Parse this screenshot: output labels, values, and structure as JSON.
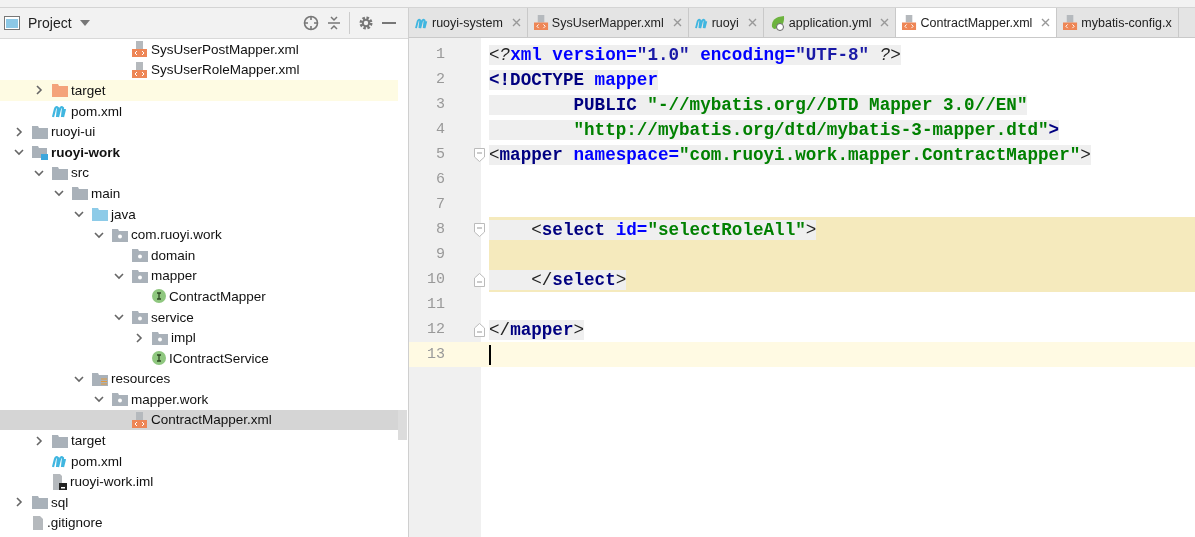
{
  "project_panel": {
    "title": "Project"
  },
  "tree": [
    {
      "children": [
        {
          "children": [
            {
              "children": [
                {
                  "children": [
                    {
                      "children": [
                        {
                          "name": "SysUserPostMapper.xml",
                          "kind": "xml",
                          "selected": false,
                          "highlighted": false
                        },
                        {
                          "name": "SysUserRoleMapper.xml",
                          "kind": "xml",
                          "selected": false,
                          "highlighted": false
                        }
                      ]
                    }
                  ]
                }
              ]
            }
          ]
        },
        {
          "name": "target",
          "kind": "excluded",
          "expanded": false,
          "selected": false,
          "highlighted": true
        },
        {
          "name": "pom.xml",
          "kind": "maven",
          "selected": false,
          "highlighted": false
        }
      ]
    },
    {
      "name": "ruoyi-ui",
      "kind": "folder",
      "expanded": false,
      "selected": false,
      "highlighted": false
    },
    {
      "name": "ruoyi-work",
      "kind": "module",
      "bold": true,
      "expanded": true,
      "selected": false,
      "highlighted": false,
      "children": [
        {
          "name": "src",
          "kind": "folder",
          "expanded": true,
          "selected": false,
          "highlighted": false,
          "children": [
            {
              "name": "main",
              "kind": "folder",
              "expanded": true,
              "selected": false,
              "highlighted": false,
              "children": [
                {
                  "name": "java",
                  "kind": "source",
                  "expanded": true,
                  "selected": false,
                  "highlighted": false,
                  "children": [
                    {
                      "name": "com.ruoyi.work",
                      "kind": "package",
                      "expanded": true,
                      "selected": false,
                      "highlighted": false,
                      "children": [
                        {
                          "name": "domain",
                          "kind": "package",
                          "selected": false,
                          "highlighted": false
                        },
                        {
                          "name": "mapper",
                          "kind": "package",
                          "expanded": true,
                          "selected": false,
                          "highlighted": false,
                          "children": [
                            {
                              "name": "ContractMapper",
                              "kind": "interface",
                              "selected": false,
                              "highlighted": false
                            }
                          ]
                        },
                        {
                          "name": "service",
                          "kind": "package",
                          "expanded": true,
                          "selected": false,
                          "highlighted": false,
                          "children": [
                            {
                              "name": "impl",
                              "kind": "package",
                              "expanded": false,
                              "selected": false,
                              "highlighted": false
                            },
                            {
                              "name": "IContractService",
                              "kind": "interface",
                              "selected": false,
                              "highlighted": false
                            }
                          ]
                        }
                      ]
                    }
                  ]
                },
                {
                  "name": "resources",
                  "kind": "resources",
                  "expanded": true,
                  "selected": false,
                  "highlighted": false,
                  "children": [
                    {
                      "name": "mapper.work",
                      "kind": "package",
                      "expanded": true,
                      "selected": false,
                      "highlighted": false,
                      "children": [
                        {
                          "name": "ContractMapper.xml",
                          "kind": "xml",
                          "selected": true,
                          "highlighted": false
                        }
                      ]
                    }
                  ]
                }
              ]
            }
          ]
        },
        {
          "name": "target",
          "kind": "folder",
          "expanded": false,
          "selected": false,
          "highlighted": false
        },
        {
          "name": "pom.xml",
          "kind": "maven",
          "selected": false,
          "highlighted": false
        },
        {
          "name": "ruoyi-work.iml",
          "kind": "iml",
          "selected": false,
          "highlighted": false
        }
      ]
    },
    {
      "name": "sql",
      "kind": "folder",
      "expanded": false,
      "selected": false,
      "highlighted": false
    },
    {
      "name": ".gitignore",
      "kind": "file",
      "selected": false,
      "highlighted": false
    }
  ],
  "tabs": [
    {
      "label": "ruoyi-system",
      "kind": "maven",
      "selected": false,
      "closable": true
    },
    {
      "label": "SysUserMapper.xml",
      "kind": "xml",
      "selected": false,
      "closable": true
    },
    {
      "label": "ruoyi",
      "kind": "maven",
      "selected": false,
      "closable": true
    },
    {
      "label": "application.yml",
      "kind": "spring",
      "selected": false,
      "closable": true
    },
    {
      "label": "ContractMapper.xml",
      "kind": "xml",
      "selected": true,
      "closable": true
    },
    {
      "label": "mybatis-config.x",
      "kind": "xml",
      "selected": false,
      "closable": false
    }
  ],
  "editor": {
    "lines": [
      {
        "number": "1",
        "fold_start": false,
        "fold_end": false,
        "highlighted": false,
        "current": false,
        "tokens": [
          {
            "kind": "pi",
            "text": "<?"
          },
          {
            "kind": "attr",
            "text": "xml version="
          },
          {
            "kind": "pivalue",
            "text": "\"1.0\""
          },
          {
            "kind": "attr",
            "text": " encoding="
          },
          {
            "kind": "pivalue",
            "text": "\"UTF-8\""
          },
          {
            "kind": "pi",
            "text": " ?>"
          }
        ]
      },
      {
        "number": "2",
        "fold_start": false,
        "fold_end": false,
        "highlighted": false,
        "current": false,
        "tokens": [
          {
            "kind": "decl",
            "text": "<!DOCTYPE"
          },
          {
            "kind": "attr",
            "text": " mapper"
          }
        ]
      },
      {
        "number": "3",
        "fold_start": false,
        "fold_end": false,
        "highlighted": false,
        "current": false,
        "tokens": [
          {
            "kind": "decl",
            "text": "        PUBLIC"
          },
          {
            "kind": "value",
            "text": " \"-//mybatis.org//DTD Mapper 3.0//EN\""
          }
        ]
      },
      {
        "number": "4",
        "fold_start": false,
        "fold_end": false,
        "highlighted": false,
        "current": false,
        "tokens": [
          {
            "kind": "value",
            "text": "        \"http://mybatis.org/dtd/mybatis-3-mapper.dtd\""
          },
          {
            "kind": "decl",
            "text": ">"
          }
        ]
      },
      {
        "number": "5",
        "fold_start": true,
        "fold_end": false,
        "highlighted": false,
        "current": false,
        "tokens": [
          {
            "kind": "punct",
            "text": "<"
          },
          {
            "kind": "tag",
            "text": "mapper"
          },
          {
            "kind": "attr",
            "text": " namespace="
          },
          {
            "kind": "value",
            "text": "\"com.ruoyi.work.mapper.ContractMapper\""
          },
          {
            "kind": "punct",
            "text": ">"
          }
        ]
      },
      {
        "number": "6",
        "fold_start": false,
        "fold_end": false,
        "highlighted": false,
        "current": false
      },
      {
        "number": "7",
        "fold_start": false,
        "fold_end": false,
        "highlighted": false,
        "current": false
      },
      {
        "number": "8",
        "fold_start": true,
        "fold_end": false,
        "highlighted": true,
        "current": false,
        "tokens": [
          {
            "kind": "punct",
            "text": "    <"
          },
          {
            "kind": "tag",
            "text": "select"
          },
          {
            "kind": "attr",
            "text": " id="
          },
          {
            "kind": "value",
            "text": "\"selectRoleAll\""
          },
          {
            "kind": "punct",
            "text": ">"
          }
        ]
      },
      {
        "number": "9",
        "fold_start": false,
        "fold_end": false,
        "highlighted": true,
        "current": false
      },
      {
        "number": "10",
        "fold_start": false,
        "fold_end": true,
        "highlighted": true,
        "current": false,
        "tokens": [
          {
            "kind": "punct",
            "text": "    </"
          },
          {
            "kind": "tag",
            "text": "select"
          },
          {
            "kind": "punct",
            "text": ">"
          }
        ]
      },
      {
        "number": "11",
        "fold_start": false,
        "fold_end": false,
        "highlighted": false,
        "current": false
      },
      {
        "number": "12",
        "fold_start": false,
        "fold_end": true,
        "highlighted": false,
        "current": false,
        "tokens": [
          {
            "kind": "punct",
            "text": "</"
          },
          {
            "kind": "tag",
            "text": "mapper"
          },
          {
            "kind": "punct",
            "text": ">"
          }
        ]
      },
      {
        "number": "13",
        "fold_start": false,
        "fold_end": false,
        "highlighted": false,
        "current": true
      }
    ]
  }
}
